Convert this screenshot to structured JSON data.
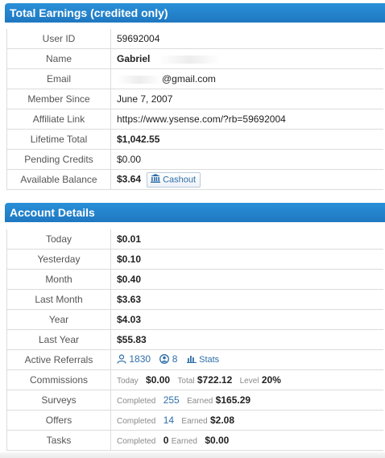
{
  "earnings": {
    "header": "Total Earnings (credited only)",
    "rows": {
      "user_id": {
        "label": "User ID",
        "value": "59692004"
      },
      "name": {
        "label": "Name",
        "value": "Gabriel"
      },
      "email": {
        "label": "Email",
        "value": "@gmail.com"
      },
      "member_since": {
        "label": "Member Since",
        "value": "June 7, 2007"
      },
      "affiliate_link": {
        "label": "Affiliate Link",
        "value": "https://www.ysense.com/?rb=59692004"
      },
      "lifetime_total": {
        "label": "Lifetime Total",
        "value": "$1,042.55"
      },
      "pending_credits": {
        "label": "Pending Credits",
        "value": "$0.00"
      },
      "available_balance": {
        "label": "Available Balance",
        "value": "$3.64",
        "cashout_label": "Cashout"
      }
    }
  },
  "account": {
    "header": "Account Details",
    "today": {
      "label": "Today",
      "value": "$0.01"
    },
    "yesterday": {
      "label": "Yesterday",
      "value": "$0.10"
    },
    "month": {
      "label": "Month",
      "value": "$0.40"
    },
    "last_month": {
      "label": "Last Month",
      "value": "$3.63"
    },
    "year": {
      "label": "Year",
      "value": "$4.03"
    },
    "last_year": {
      "label": "Last Year",
      "value": "$55.83"
    },
    "referrals": {
      "label": "Active Referrals",
      "count": "1830",
      "active": "8",
      "stats_label": "Stats"
    },
    "commissions": {
      "label": "Commissions",
      "today_label": "Today",
      "today_value": "$0.00",
      "total_label": "Total",
      "total_value": "$722.12",
      "level_label": "Level",
      "level_value": "20%"
    },
    "surveys": {
      "label": "Surveys",
      "completed_label": "Completed",
      "completed": "255",
      "earned_label": "Earned",
      "earned": "$165.29"
    },
    "offers": {
      "label": "Offers",
      "completed_label": "Completed",
      "completed": "14",
      "earned_label": "Earned",
      "earned": "$2.08"
    },
    "tasks": {
      "label": "Tasks",
      "completed_label": "Completed",
      "completed": "0",
      "earned_label": "Earned",
      "earned": "$0.00"
    }
  },
  "colors": {
    "header_bg": "#1f78c1",
    "link": "#2f6ea8"
  },
  "icons": {
    "cashout": "bank-icon",
    "referrals": "user-icon",
    "active": "user-circle-icon",
    "stats": "bar-chart-icon"
  }
}
